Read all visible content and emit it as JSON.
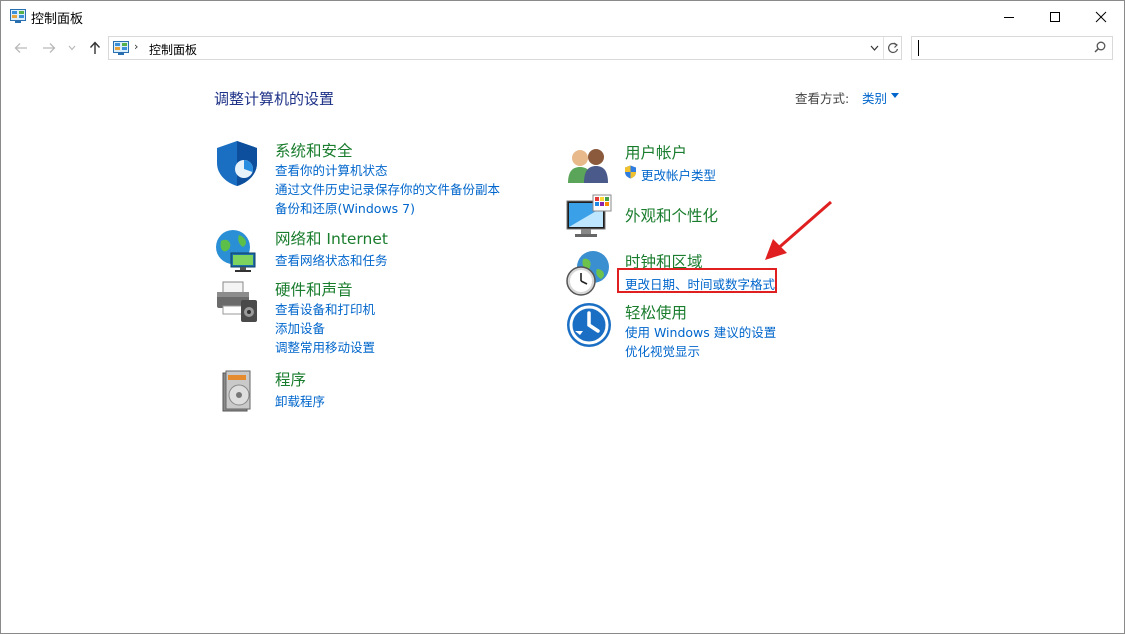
{
  "window": {
    "title": "控制面板"
  },
  "address": {
    "path": "控制面板",
    "separator": "›"
  },
  "search": {
    "placeholder": ""
  },
  "main": {
    "heading": "调整计算机的设置",
    "view_by_label": "查看方式:",
    "view_by_value": "类别"
  },
  "categories": {
    "security": {
      "title": "系统和安全",
      "links": [
        "查看你的计算机状态",
        "通过文件历史记录保存你的文件备份副本",
        "备份和还原(Windows 7)"
      ]
    },
    "network": {
      "title": "网络和 Internet",
      "links": [
        "查看网络状态和任务"
      ]
    },
    "hardware": {
      "title": "硬件和声音",
      "links": [
        "查看设备和打印机",
        "添加设备",
        "调整常用移动设置"
      ]
    },
    "programs": {
      "title": "程序",
      "links": [
        "卸载程序"
      ]
    },
    "users": {
      "title": "用户帐户",
      "links": [
        "更改帐户类型"
      ]
    },
    "appearance": {
      "title": "外观和个性化",
      "links": []
    },
    "clock": {
      "title": "时钟和区域",
      "links": [
        "更改日期、时间或数字格式"
      ]
    },
    "ease": {
      "title": "轻松使用",
      "links": [
        "使用 Windows 建议的设置",
        "优化视觉显示"
      ]
    }
  },
  "colors": {
    "category_title": "#1a7d2e",
    "link": "#0066cc",
    "heading": "#1e3287",
    "annotation": "#e02020"
  },
  "icons": {
    "title": "control-panel-icon",
    "security": "shield-icon",
    "network": "globe-network-icon",
    "hardware": "printer-icon",
    "programs": "programs-disk-icon",
    "users": "users-icon",
    "appearance": "monitor-palette-icon",
    "clock": "clock-globe-icon",
    "ease": "ease-of-access-icon"
  }
}
